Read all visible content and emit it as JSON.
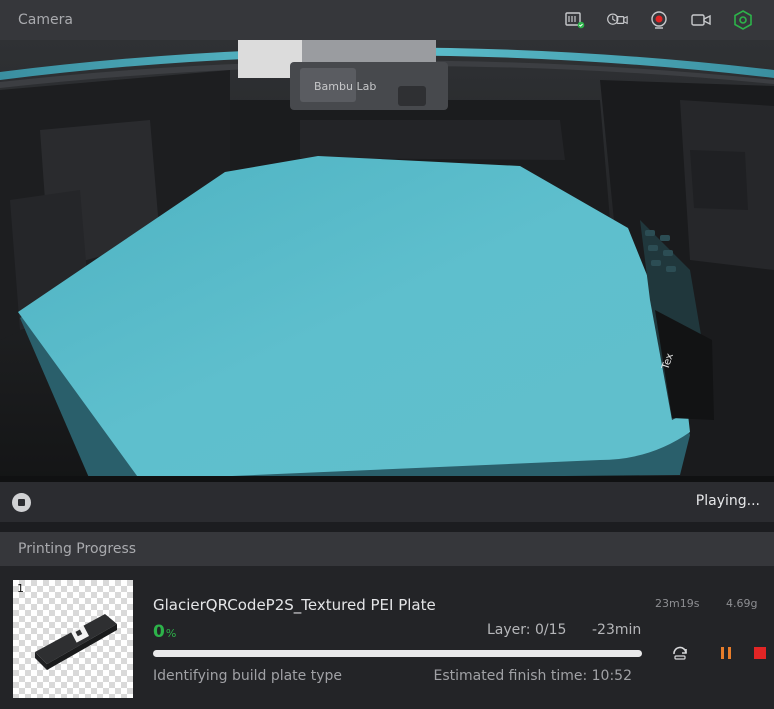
{
  "camera": {
    "title": "Camera",
    "status": "Playing...",
    "toolbar": [
      {
        "name": "sdcard-icon"
      },
      {
        "name": "timelapse-icon"
      },
      {
        "name": "recording-icon"
      },
      {
        "name": "video-icon"
      },
      {
        "name": "settings-hexagon-icon"
      }
    ],
    "feed_labels": {
      "printer_brand": "Bambu Lab",
      "plate_logo": "Tex"
    }
  },
  "progress": {
    "title": "Printing Progress",
    "plate_index": "1",
    "job_name": "GlacierQRCodeP2S_Textured PEI Plate",
    "time_cost": "23m19s",
    "weight": "4.69g",
    "percent_value": "0",
    "percent_sign": "%",
    "progress_fraction": 0,
    "layer": "Layer: 0/15",
    "remaining": "-23min",
    "stage": "Identifying build plate type",
    "finish": "Estimated finish time: 10:52"
  },
  "colors": {
    "accent_green": "#2db34a",
    "pause_orange": "#e87d2a",
    "stop_red": "#e22525"
  }
}
